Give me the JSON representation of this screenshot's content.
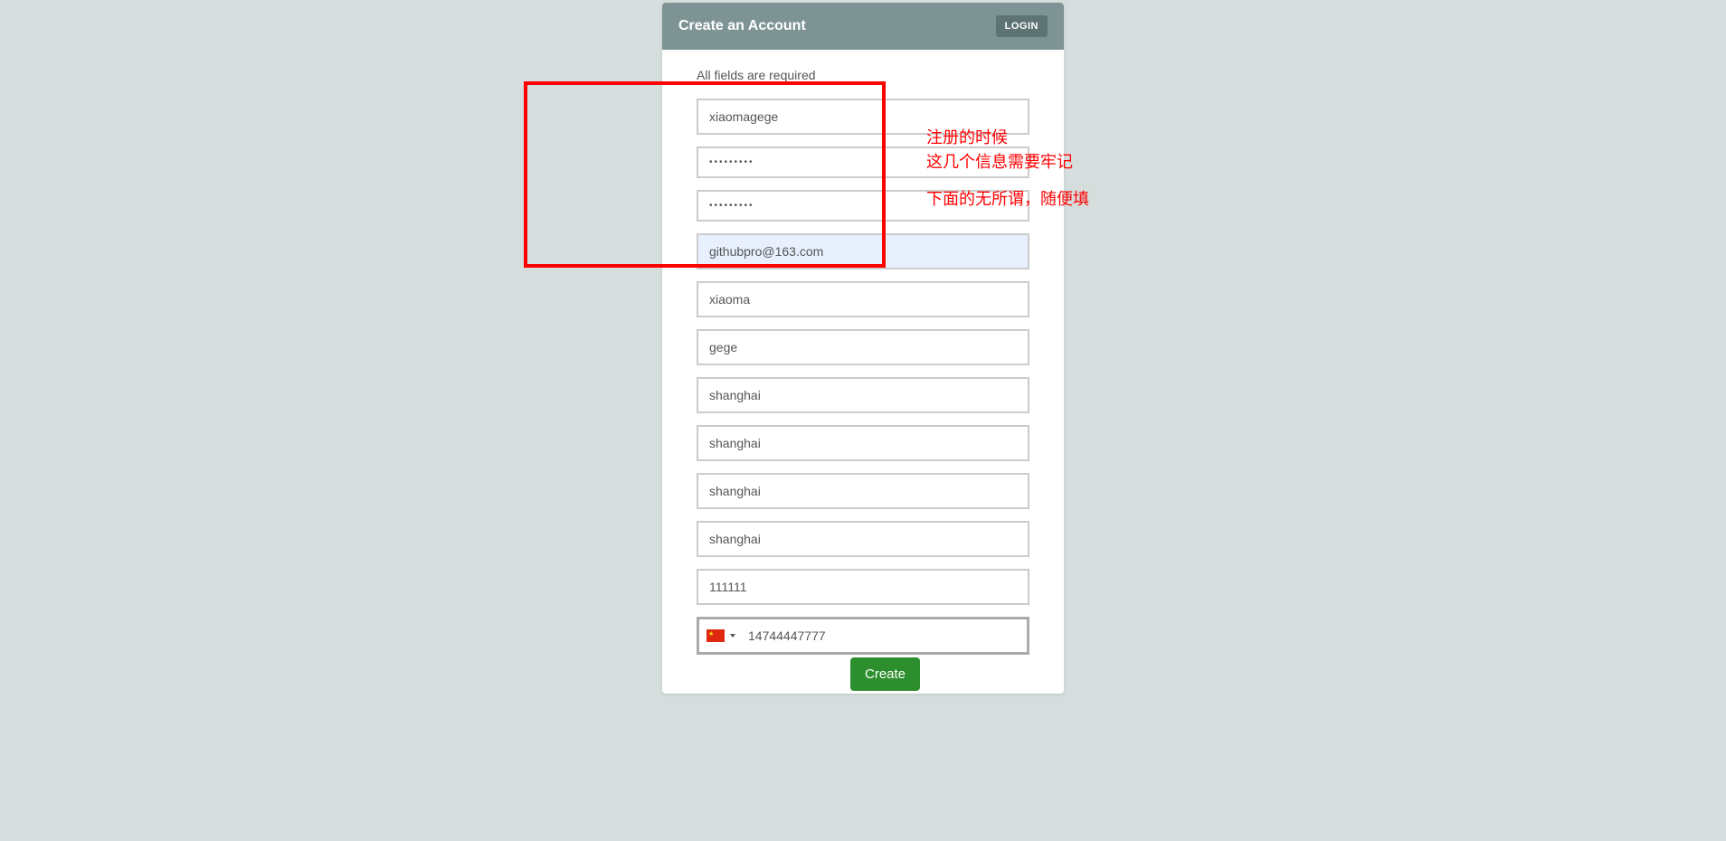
{
  "header": {
    "title": "Create an Account",
    "loginButton": "LOGIN"
  },
  "form": {
    "requiredText": "All fields are required",
    "username": "xiaomagege",
    "password": "•••••••••",
    "passwordConfirm": "•••••••••",
    "email": "githubpro@163.com",
    "firstName": "xiaoma",
    "lastName": "gege",
    "city1": "shanghai",
    "city2": "shanghai",
    "city3": "shanghai",
    "city4": "shanghai",
    "zipcode": "111111",
    "phone": "14744447777",
    "createButton": "Create"
  },
  "annotations": {
    "line1": "注册的时候",
    "line2": "这几个信息需要牢记",
    "line3": "下面的无所谓，随便填"
  }
}
